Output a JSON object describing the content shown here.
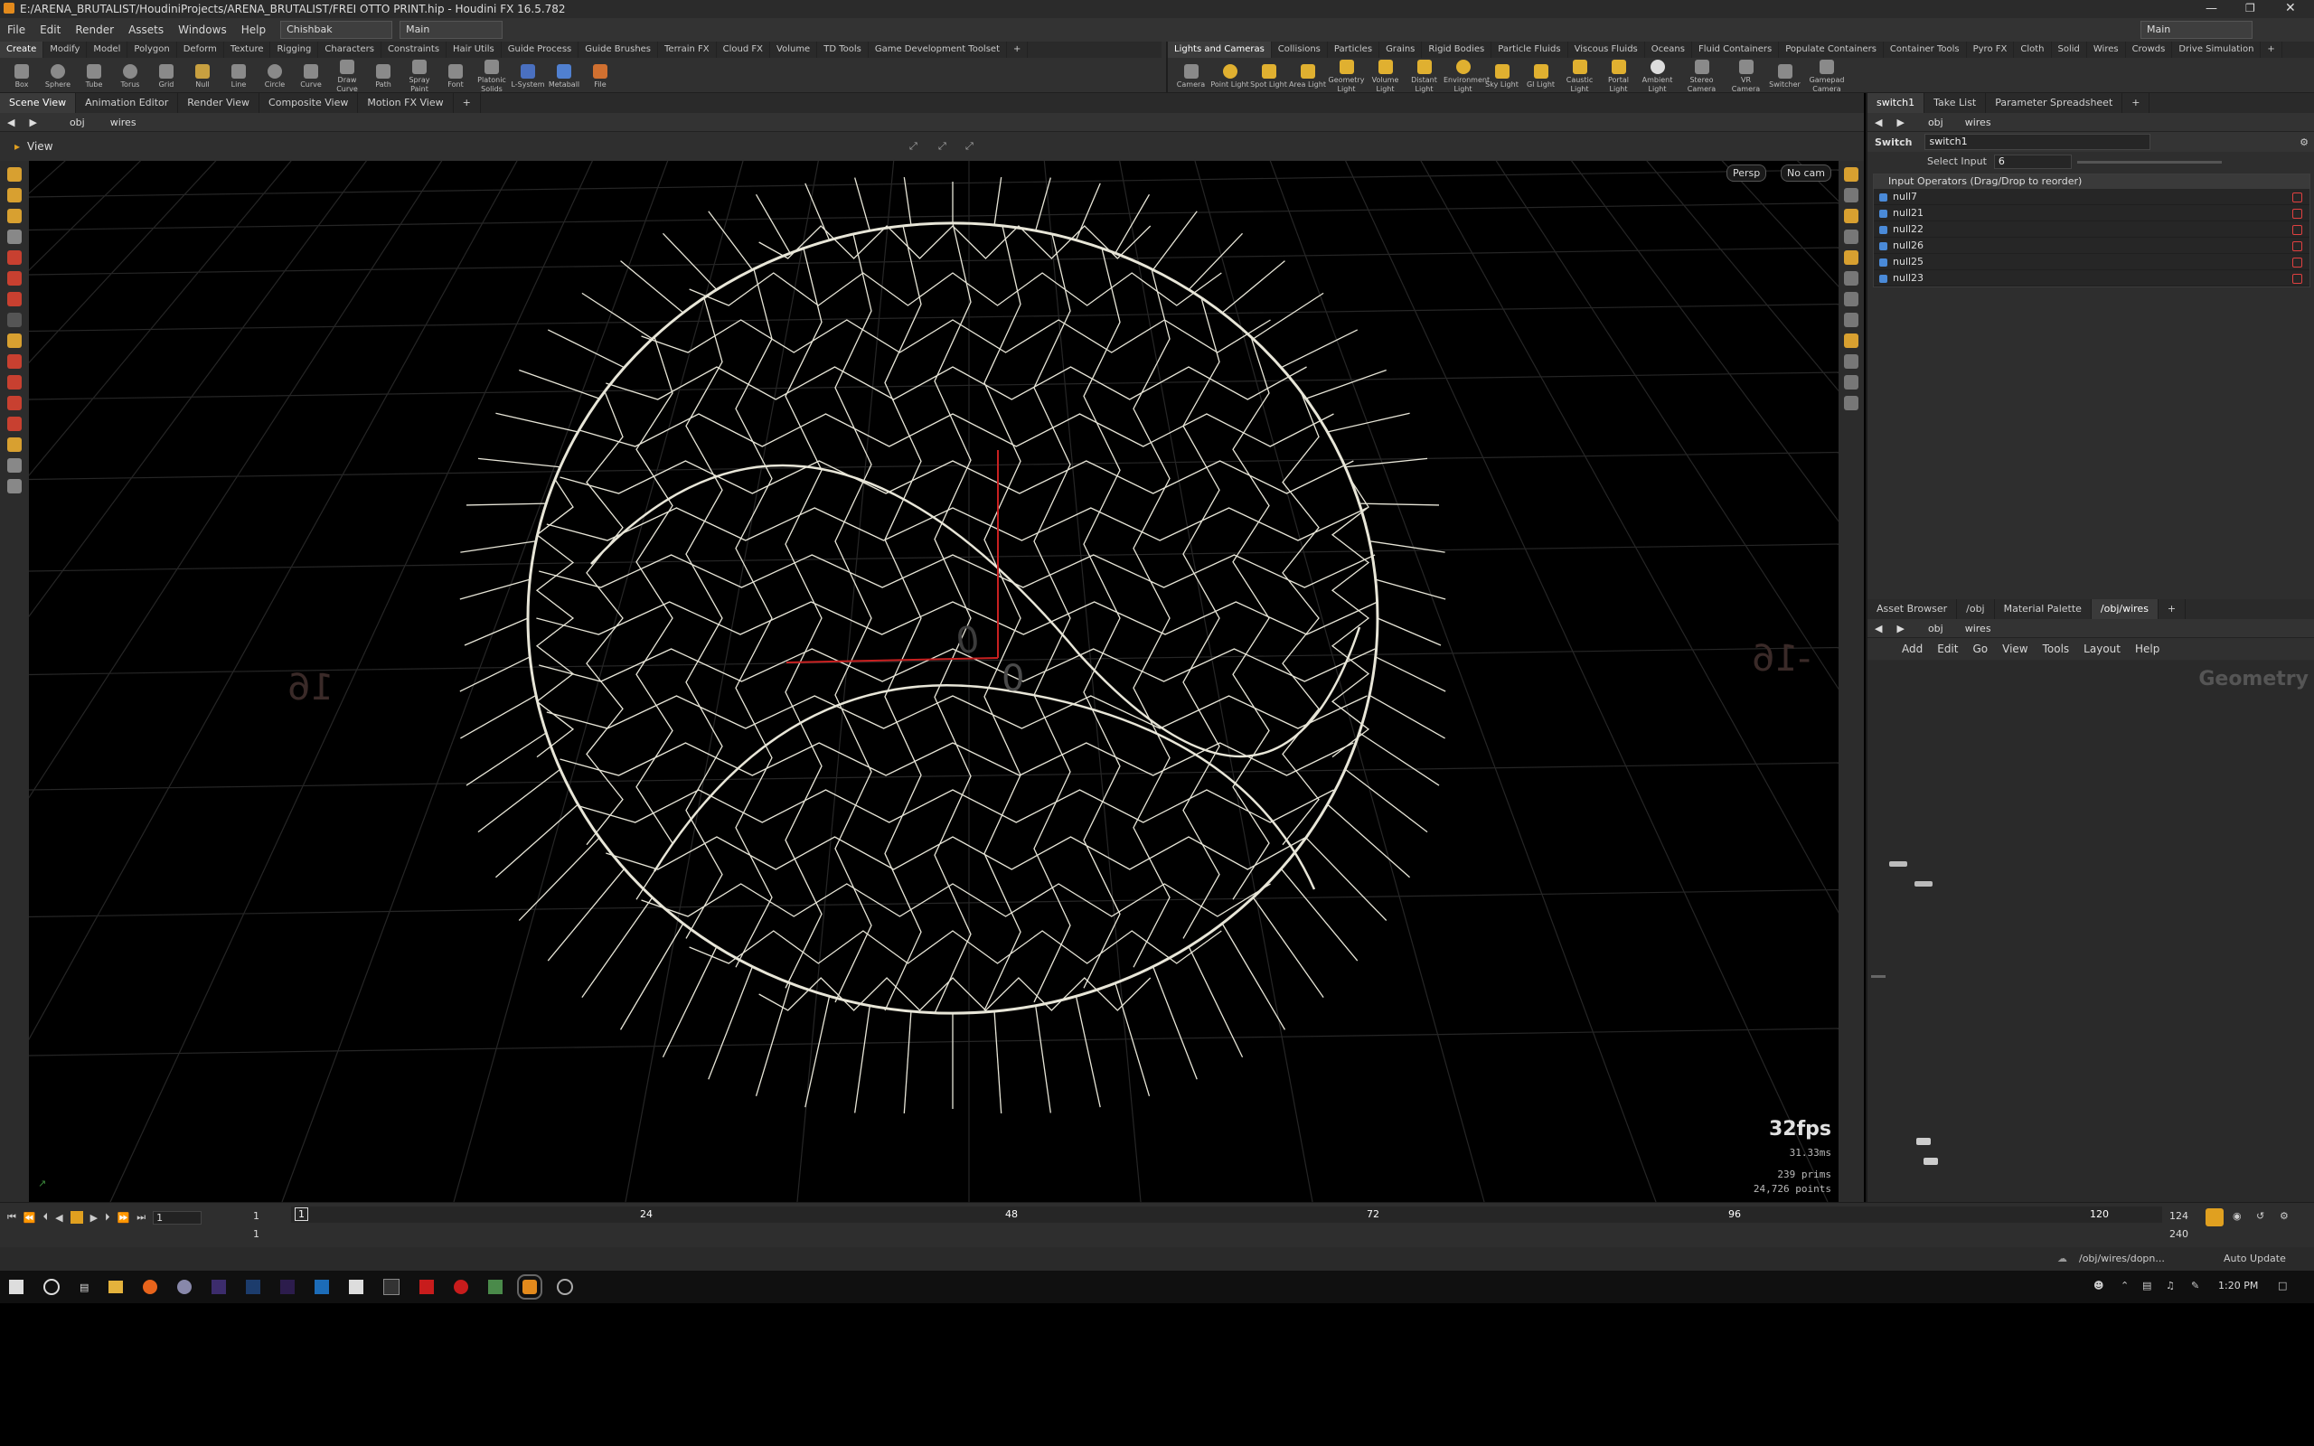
{
  "window": {
    "title": "E:/ARENA_BRUTALIST/HoudiniProjects/ARENA_BRUTALIST/FREI OTTO PRINT.hip - Houdini FX 16.5.782"
  },
  "menubar": {
    "items": [
      "File",
      "Edit",
      "Render",
      "Assets",
      "Windows",
      "Help"
    ],
    "desktop": "Chishbak",
    "layout": "Main",
    "right_desktop": "Main"
  },
  "shelf_left": {
    "tabs": [
      "Create",
      "Modify",
      "Model",
      "Polygon",
      "Deform",
      "Texture",
      "Rigging",
      "Characters",
      "Constraints",
      "Hair Utils",
      "Guide Process",
      "Guide Brushes",
      "Terrain FX",
      "Cloud FX",
      "Volume",
      "TD Tools",
      "Game Development Toolset"
    ],
    "tools": [
      "Box",
      "Sphere",
      "Tube",
      "Torus",
      "Grid",
      "Null",
      "Line",
      "Circle",
      "Curve",
      "Draw Curve",
      "Path",
      "Spray Paint",
      "Font",
      "Platonic Solids",
      "L-System",
      "Metaball",
      "File"
    ]
  },
  "shelf_right": {
    "tabs": [
      "Lights and Cameras",
      "Collisions",
      "Particles",
      "Grains",
      "Rigid Bodies",
      "Particle Fluids",
      "Viscous Fluids",
      "Oceans",
      "Fluid Containers",
      "Populate Containers",
      "Container Tools",
      "Pyro FX",
      "Cloth",
      "Solid",
      "Wires",
      "Crowds",
      "Drive Simulation"
    ],
    "tools": [
      "Camera",
      "Point Light",
      "Spot Light",
      "Area Light",
      "Geometry Light",
      "Volume Light",
      "Distant Light",
      "Environment Light",
      "Sky Light",
      "GI Light",
      "Caustic Light",
      "Portal Light",
      "Ambient Light",
      "Stereo Camera",
      "VR Camera",
      "Switcher",
      "Gamepad Camera"
    ]
  },
  "scene_tabs": [
    "Scene View",
    "Animation Editor",
    "Render View",
    "Composite View",
    "Motion FX View"
  ],
  "scene_path": {
    "root": "obj",
    "node": "wires"
  },
  "viewport": {
    "label": "View",
    "persp": "Persp",
    "camera": "No cam",
    "grid_label_left": "16",
    "grid_label_center": "0",
    "grid_label_center2": "0",
    "grid_label_right": "-16",
    "fps": "32fps",
    "ms": "31.33ms",
    "prims": "239  prims",
    "points": "24,726 points"
  },
  "param_panel": {
    "tabs": [
      "switch1",
      "Take List",
      "Parameter Spreadsheet"
    ],
    "path_root": "obj",
    "path_node": "wires",
    "node_type": "Switch",
    "node_name": "switch1",
    "select_input_label": "Select Input",
    "select_input_value": "6",
    "input_header": "Input Operators (Drag/Drop to reorder)",
    "inputs": [
      "null7",
      "null21",
      "null22",
      "null26",
      "null25",
      "null23"
    ]
  },
  "network_panel": {
    "tabs": [
      "Asset Browser",
      "/obj",
      "Material Palette",
      "/obj/wires"
    ],
    "path_root": "obj",
    "path_node": "wires",
    "menu": [
      "Add",
      "Edit",
      "Go",
      "View",
      "Tools",
      "Layout",
      "Help"
    ],
    "context_label": "Geometry"
  },
  "timeline": {
    "frame": "1",
    "start": "1",
    "start2": "1",
    "end": "124",
    "end2": "240",
    "ticks": [
      "24",
      "48",
      "72",
      "96",
      "120"
    ]
  },
  "statusbar": {
    "path": "/obj/wires/dopn...",
    "update": "Auto Update"
  },
  "taskbar": {
    "time": "1:20 PM"
  },
  "colors": {
    "accent": "#f0a020",
    "wire": "#e8e6d8",
    "axis": "#c82020",
    "bg": "#000000"
  }
}
